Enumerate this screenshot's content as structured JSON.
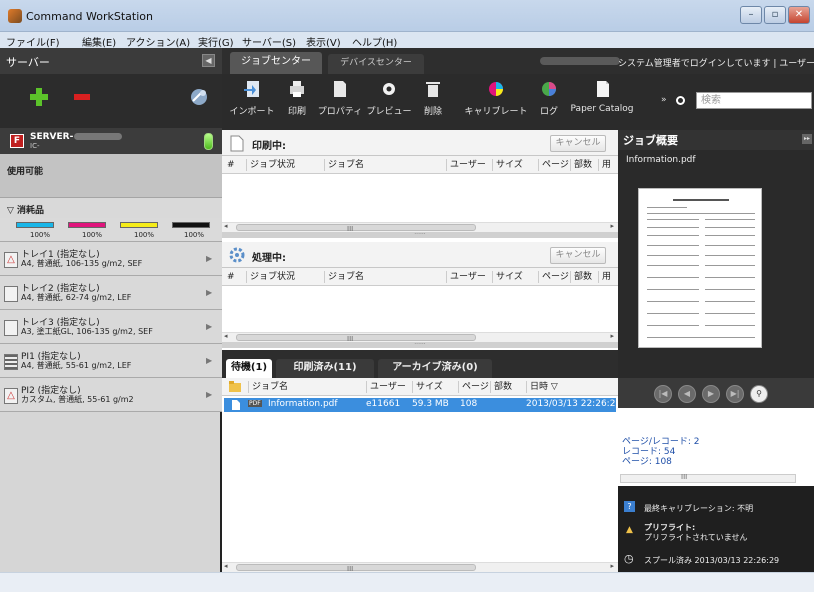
{
  "window": {
    "title": "Command WorkStation",
    "min": "–",
    "max": "▫",
    "close": "✕"
  },
  "menu": [
    "ファイル(F)",
    "編集(E)",
    "アクション(A)",
    "実行(G)",
    "サーバー(S)",
    "表示(V)",
    "ヘルプ(H)"
  ],
  "sidebar": {
    "title": "サーバー",
    "collapse": "◀",
    "server_name": "SERVER-",
    "server_sub": "IC-",
    "server_icon": "F",
    "status": "使用可能",
    "supplies_label": "▽ 消耗品",
    "toners": [
      {
        "color": "#19b6e8",
        "pct": "100%"
      },
      {
        "color": "#e0147c",
        "pct": "100%"
      },
      {
        "color": "#f5ec19",
        "pct": "100%"
      },
      {
        "color": "#111111",
        "pct": "100%"
      }
    ],
    "trays": [
      {
        "name": "トレイ1 (指定なし)",
        "desc": "A4, 普通紙, 106-135 g/m2, SEF",
        "warn": true
      },
      {
        "name": "トレイ2 (指定なし)",
        "desc": "A4, 普通紙, 62-74 g/m2, LEF",
        "warn": false
      },
      {
        "name": "トレイ3 (指定なし)",
        "desc": "A3, 塗工紙GL, 106-135 g/m2, SEF",
        "warn": false
      },
      {
        "name": "PI1 (指定なし)",
        "desc": "A4, 普通紙, 55-61 g/m2, LEF",
        "warn": false
      },
      {
        "name": "PI2 (指定なし)",
        "desc": "カスタム, 普通紙, 55-61 g/m2",
        "warn": true
      }
    ]
  },
  "tabs": {
    "job_center": "ジョブセンター",
    "device_center": "デバイスセンター"
  },
  "login_text": "システム管理者でログインしています | ユーザー変更",
  "toolbar": [
    {
      "label": "インポート",
      "icon": "import-icon"
    },
    {
      "label": "印刷",
      "icon": "print-icon"
    },
    {
      "label": "プロパティ",
      "icon": "properties-icon"
    },
    {
      "label": "プレビュー",
      "icon": "preview-icon"
    },
    {
      "label": "削除",
      "icon": "delete-icon"
    },
    {
      "label": "キャリブレート",
      "icon": "calibrate-icon"
    },
    {
      "label": "ログ",
      "icon": "log-icon"
    },
    {
      "label": "Paper Catalog",
      "icon": "paper-catalog-icon"
    }
  ],
  "search": {
    "placeholder": "検索",
    "chevron": "»"
  },
  "printing": {
    "title": "印刷中:",
    "cancel": "キャンセル",
    "columns": [
      "#",
      "ジョブ状況",
      "ジョブ名",
      "ユーザー",
      "サイズ",
      "ページ",
      "部数",
      "用"
    ]
  },
  "processing": {
    "title": "処理中:",
    "cancel": "キャンセル",
    "columns": [
      "#",
      "ジョブ状況",
      "ジョブ名",
      "ユーザー",
      "サイズ",
      "ページ",
      "部数",
      "用"
    ]
  },
  "scroll": {
    "grip": "III",
    "left": "◂",
    "right": "▸",
    "split": "······"
  },
  "hold_tabs": {
    "held": "待機(1)",
    "printed": "印刷済み(11)",
    "archived": "アーカイブ済み(0)"
  },
  "hold_columns": [
    "ジョブ名",
    "ユーザー",
    "サイズ",
    "ページ",
    "部数",
    "日時 ▽"
  ],
  "job": {
    "type": "PDF",
    "name": "Information.pdf",
    "user": "e11661",
    "size": "59.3 MB",
    "pages": "108",
    "copies": "",
    "date": "2013/03/13 22:26:28"
  },
  "summary": {
    "title": "ジョブ概要",
    "file": "Information.pdf",
    "barcode": "ページ/レコード: 2",
    "records": "レコード: 54",
    "pages": "ページ: 108",
    "calibration": "最終キャリブレーション: 不明",
    "preflight_title": "プリフライト:",
    "preflight_text": "プリフライトされていません",
    "spooled": "スプール済み 2013/03/13 22:26:29",
    "grip": "III",
    "info_icon": "?",
    "warn_icon": "▲",
    "clock_icon": "◷",
    "expand": "▸▸",
    "pager": [
      "|◀",
      "◀",
      "▶",
      "▶|",
      "⚲"
    ]
  }
}
